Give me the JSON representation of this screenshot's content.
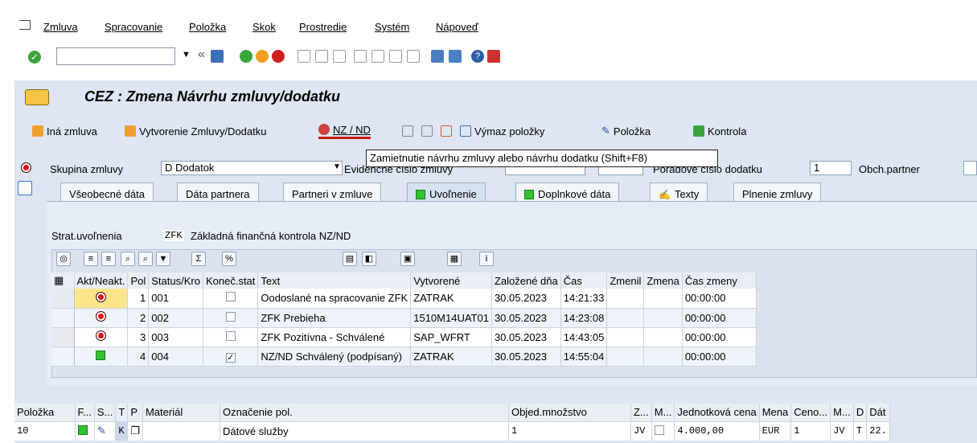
{
  "menu": [
    "Zmluva",
    "Spracovanie",
    "Položka",
    "Skok",
    "Prostredie",
    "Systém",
    "Nápoveď"
  ],
  "title": "CEZ : Zmena Návrhu zmluvy/dodatku",
  "app_toolbar": {
    "other_contract": "Iná zmluva",
    "create_contract": "Vytvorenie Zmluvy/Dodatku",
    "nz_nd": "NZ / ND",
    "delete_items": "Výmaz položky",
    "item": "Položka",
    "check": "Kontrola"
  },
  "tooltip": "Zamietnutie návrhu zmluvy alebo návrhu dodatku   (Shift+F8)",
  "header_fields": {
    "group_label": "Skupina zmluvy",
    "group_value": "D Dodatok",
    "evid_label": "Evidenčné číslo zmluvy",
    "addendum_label": "Poradové číslo dodatku",
    "addendum_value": "1",
    "partner_label": "Obch.partner"
  },
  "tabs": [
    "Všeobecné dáta",
    "Dáta partnera",
    "Partneri v zmluve",
    "Uvoľnenie",
    "Doplnkové dáta",
    "Texty",
    "Plnenie zmluvy"
  ],
  "release": {
    "strategy_label": "Strat.uvoľnenia",
    "strategy_code": "ZFK",
    "strategy_text": "Základná finančná kontrola NZ/ND"
  },
  "status_table": {
    "columns": [
      "Akt/Neakt.",
      "Pol",
      "Status/Kro",
      "Koneč.stat",
      "Text",
      "Vytvorené",
      "Založené dňa",
      "Čas",
      "Zmenil",
      "Zmena",
      "Čas zmeny"
    ],
    "rows": [
      {
        "light": "red",
        "pol": "1",
        "status": "001",
        "final": false,
        "text": "Oodoslané na spracovanie ZFK",
        "created_by": "ZATRAK",
        "date": "30.05.2023",
        "time": "14:21:33",
        "changed_by": "",
        "change": "",
        "change_time": "00:00:00"
      },
      {
        "light": "red",
        "pol": "2",
        "status": "002",
        "final": false,
        "text": "ZFK Prebieha",
        "created_by": "1510M14UAT01",
        "date": "30.05.2023",
        "time": "14:23:08",
        "changed_by": "",
        "change": "",
        "change_time": "00:00:00"
      },
      {
        "light": "red",
        "pol": "3",
        "status": "003",
        "final": false,
        "text": "ZFK Pozitívna - Schválené",
        "created_by": "SAP_WFRT",
        "date": "30.05.2023",
        "time": "14:43:05",
        "changed_by": "",
        "change": "",
        "change_time": "00:00:00"
      },
      {
        "light": "green",
        "pol": "4",
        "status": "004",
        "final": true,
        "text": "NZ/ND Schválený (podpísaný)",
        "created_by": "ZATRAK",
        "date": "30.05.2023",
        "time": "14:55:04",
        "changed_by": "",
        "change": "",
        "change_time": "00:00:00"
      }
    ]
  },
  "items_table": {
    "columns": [
      "Položka",
      "F...",
      "S...",
      "T",
      "P",
      "Materiál",
      "Označenie pol.",
      "Objed.množstvo",
      "Z...",
      "M...",
      "Jednotková cena",
      "Mena",
      "Ceno...",
      "M...",
      "D",
      "Dát"
    ],
    "rows": [
      {
        "item": "10",
        "t": "K",
        "material": "",
        "desc": "Dátové služby",
        "qty": "1",
        "z": "JV",
        "price": "4.000,00",
        "currency": "EUR",
        "ceno": "1",
        "m": "JV",
        "d": "T",
        "dat": "22."
      }
    ]
  },
  "colors": {
    "panel_bg": "#dde6f2",
    "accent_red": "#d01818",
    "green": "#2ec52e"
  }
}
